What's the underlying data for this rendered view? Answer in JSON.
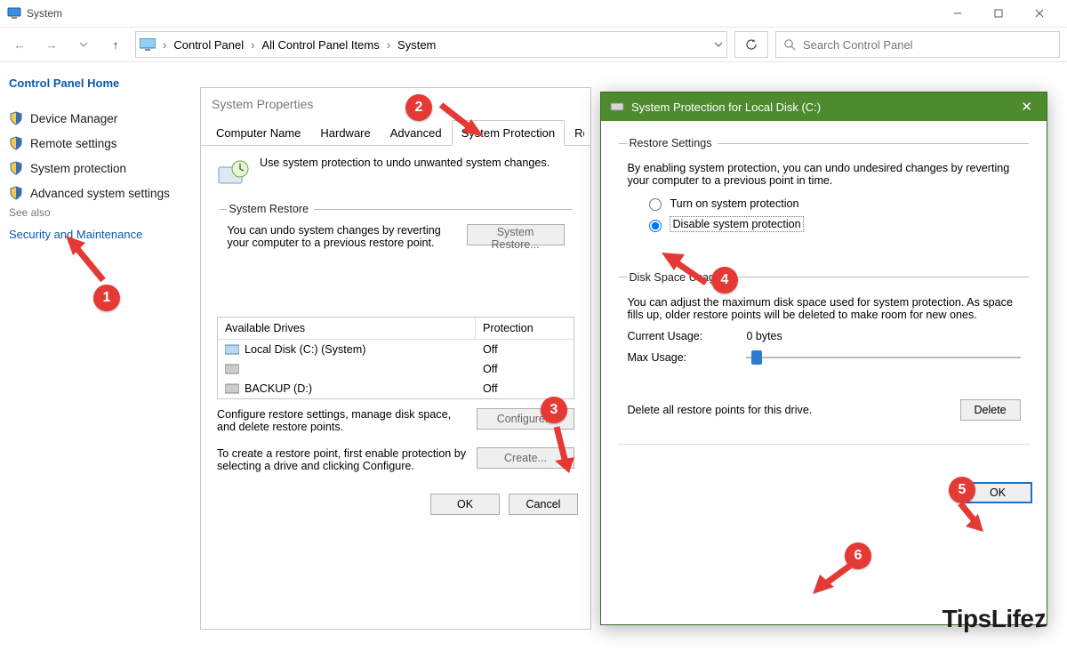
{
  "titlebar": {
    "title": "System"
  },
  "navbar": {
    "crumbs": [
      "Control Panel",
      "All Control Panel Items",
      "System"
    ],
    "search_placeholder": "Search Control Panel"
  },
  "sidebar": {
    "home": "Control Panel Home",
    "items": [
      "Device Manager",
      "Remote settings",
      "System protection",
      "Advanced system settings"
    ],
    "see_also_head": "See also",
    "see_also_link": "Security and Maintenance"
  },
  "sysprops": {
    "title": "System Properties",
    "tabs": [
      "Computer Name",
      "Hardware",
      "Advanced",
      "System Protection",
      "Remote"
    ],
    "active_tab": 3,
    "intro": "Use system protection to undo unwanted system changes.",
    "restore_legend": "System Restore",
    "restore_text": "You can undo system changes by reverting your computer to a previous restore point.",
    "restore_btn": "System Restore...",
    "drives_header": {
      "col1": "Available Drives",
      "col2": "Protection"
    },
    "drives": [
      {
        "name": "Local Disk (C:) (System)",
        "prot": "Off"
      },
      {
        "name": "",
        "prot": "Off"
      },
      {
        "name": "BACKUP (D:)",
        "prot": "Off"
      }
    ],
    "configure_text": "Configure restore settings, manage disk space, and delete restore points.",
    "configure_btn": "Configure...",
    "create_text": "To create a restore point, first enable protection by selecting a drive and clicking Configure.",
    "create_btn": "Create...",
    "ok": "OK",
    "cancel": "Cancel"
  },
  "spdlg": {
    "title": "System Protection for Local Disk (C:)",
    "restore_legend": "Restore Settings",
    "restore_text": "By enabling system protection, you can undo undesired changes by reverting your computer to a previous point in time.",
    "radio_on": "Turn on system protection",
    "radio_off": "Disable system protection",
    "space_legend": "Disk Space Usage",
    "space_text": "You can adjust the maximum disk space used for system protection. As space fills up, older restore points will be deleted to make room for new ones.",
    "current_label": "Current Usage:",
    "current_value": "0 bytes",
    "max_label": "Max Usage:",
    "delete_text": "Delete all restore points for this drive.",
    "delete_btn": "Delete",
    "ok": "OK"
  },
  "badges": {
    "b1": "1",
    "b2": "2",
    "b3": "3",
    "b4": "4",
    "b5": "5",
    "b6": "6"
  },
  "watermark": {
    "pre": "Tips",
    "life": "Life",
    "z": "z"
  }
}
